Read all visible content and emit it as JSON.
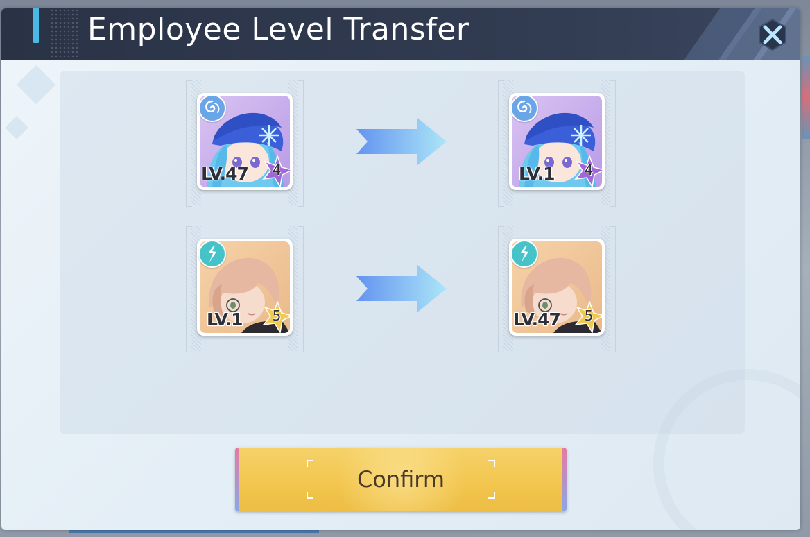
{
  "dialog": {
    "title": "Employee Level Transfer",
    "close_icon": "close-x-icon"
  },
  "transfers": [
    {
      "from": {
        "level_label": "LV.47",
        "stars": "4",
        "element_icon": "water-swirl-icon",
        "star_color": "#a366d6"
      },
      "to": {
        "level_label": "LV.1",
        "stars": "4",
        "element_icon": "water-swirl-icon",
        "star_color": "#a366d6"
      }
    },
    {
      "from": {
        "level_label": "LV.1",
        "stars": "5",
        "element_icon": "lightning-icon",
        "star_color": "#f2c94c"
      },
      "to": {
        "level_label": "LV.47",
        "stars": "5",
        "element_icon": "lightning-icon",
        "star_color": "#f2c94c"
      }
    }
  ],
  "confirm": {
    "label": "Confirm"
  },
  "colors": {
    "title_bar": "#2f394d",
    "accent": "#4cb8e6",
    "confirm_gold": "#f3c64f",
    "arrow_blue": "#7fb2f5"
  }
}
